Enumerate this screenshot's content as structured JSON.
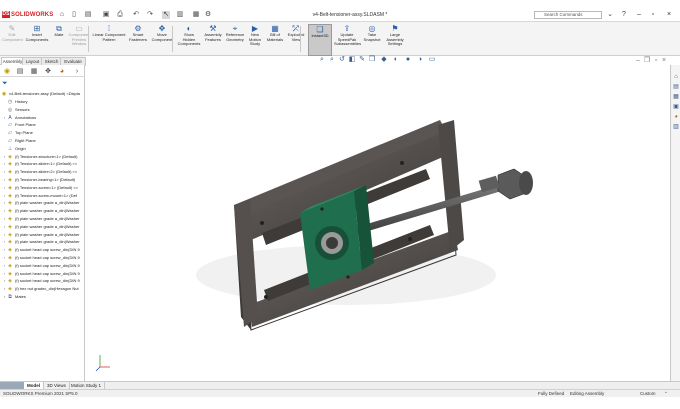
{
  "app": {
    "brand": "SOLIDWORKS",
    "document_title": "v4-Belt-tensioner-assy.SLDASM *",
    "search_placeholder": "Search Commands"
  },
  "command_manager": {
    "items": [
      {
        "label": "Edit\nComponent",
        "icon": "edit-component-icon",
        "disabled": true
      },
      {
        "label": "Insert\nComponents",
        "icon": "insert-components-icon",
        "disabled": false
      },
      {
        "label": "Mate",
        "icon": "mate-icon",
        "disabled": false
      },
      {
        "label": "Component\nPreview\nWindow",
        "icon": "preview-window-icon",
        "disabled": true
      },
      {
        "label": "Linear Component\nPattern",
        "icon": "linear-pattern-icon",
        "disabled": false
      },
      {
        "label": "Smart\nFasteners",
        "icon": "smart-fasteners-icon",
        "disabled": false
      },
      {
        "label": "Move\nComponent",
        "icon": "move-component-icon",
        "disabled": false
      },
      {
        "label": "Show\nHidden\nComponents",
        "icon": "show-hidden-icon",
        "disabled": false
      },
      {
        "label": "Assembly\nFeatures",
        "icon": "assembly-features-icon",
        "disabled": false
      },
      {
        "label": "Reference\nGeometry",
        "icon": "reference-geometry-icon",
        "disabled": false
      },
      {
        "label": "New\nMotion\nStudy",
        "icon": "motion-study-icon",
        "disabled": false
      },
      {
        "label": "Bill of\nMaterials",
        "icon": "bill-of-materials-icon",
        "disabled": false
      },
      {
        "label": "Exploded\nView",
        "icon": "exploded-view-icon",
        "disabled": false
      },
      {
        "label": "Instant3D",
        "icon": "instant3d-icon",
        "disabled": false,
        "active": true
      },
      {
        "label": "Update\nSpeedPak\nSubassemblies",
        "icon": "speedpak-icon",
        "disabled": false
      },
      {
        "label": "Take\nSnapshot",
        "icon": "snapshot-icon",
        "disabled": false
      },
      {
        "label": "Large\nAssembly\nSettings",
        "icon": "large-assembly-icon",
        "disabled": false
      }
    ]
  },
  "tabs": [
    "Assembly",
    "Layout",
    "Sketch",
    "Evaluate"
  ],
  "feature_tree": {
    "root": "v4-Belt-tensioner-assy (Default) <Displa",
    "items": [
      {
        "label": "History",
        "icon": "history-icon",
        "expander": ""
      },
      {
        "label": "Sensors",
        "icon": "sensors-icon",
        "expander": ""
      },
      {
        "label": "Annotations",
        "icon": "annotations-icon",
        "expander": "›"
      },
      {
        "label": "Front Plane",
        "icon": "plane-icon",
        "expander": ""
      },
      {
        "label": "Top Plane",
        "icon": "plane-icon",
        "expander": ""
      },
      {
        "label": "Right Plane",
        "icon": "plane-icon",
        "expander": ""
      },
      {
        "label": "Origin",
        "icon": "origin-icon",
        "expander": ""
      },
      {
        "label": "(f) Tensioner-structure<1> (Default)",
        "icon": "part-icon",
        "expander": "›"
      },
      {
        "label": "(f) Tensioner-slider<1> (Default) <<",
        "icon": "part-icon",
        "expander": "›"
      },
      {
        "label": "(f) Tensioner-slider<2> (Default) <<",
        "icon": "part-icon",
        "expander": "›"
      },
      {
        "label": "(f) Tensioner-bearing<1> (Default)",
        "icon": "part-icon",
        "expander": "›"
      },
      {
        "label": "(f) Tensioner-screw<1> (Default) <<",
        "icon": "part-icon",
        "expander": "›"
      },
      {
        "label": "(f) Tensioner-screw-mount<1> (Def",
        "icon": "part-icon",
        "expander": "›"
      },
      {
        "label": "(f) plain washer grade a_din(Washer",
        "icon": "part-icon",
        "expander": "›"
      },
      {
        "label": "(f) plain washer grade a_din(Washer",
        "icon": "part-icon",
        "expander": "›"
      },
      {
        "label": "(f) plain washer grade a_din(Washer",
        "icon": "part-icon",
        "expander": "›"
      },
      {
        "label": "(f) plain washer grade a_din(Washer",
        "icon": "part-icon",
        "expander": "›"
      },
      {
        "label": "(f) plain washer grade a_din(Washer",
        "icon": "part-icon",
        "expander": "›"
      },
      {
        "label": "(f) plain washer grade a_din(Washer",
        "icon": "part-icon",
        "expander": "›"
      },
      {
        "label": "(f) socket head cap screw_din(DIN 9",
        "icon": "part-icon",
        "expander": "›"
      },
      {
        "label": "(f) socket head cap screw_din(DIN 9",
        "icon": "part-icon",
        "expander": "›"
      },
      {
        "label": "(f) socket head cap screw_din(DIN 9",
        "icon": "part-icon",
        "expander": "›"
      },
      {
        "label": "(f) socket head cap screw_din(DIN 9",
        "icon": "part-icon",
        "expander": "›"
      },
      {
        "label": "(f) socket head cap screw_din(DIN 9",
        "icon": "part-icon",
        "expander": "›"
      },
      {
        "label": "(f) hex nut gradec_din(Hexagon Nut",
        "icon": "part-icon",
        "expander": "›"
      },
      {
        "label": "Mates",
        "icon": "mates-icon",
        "expander": "›"
      }
    ]
  },
  "bottom_tabs": [
    "Model",
    "3D Views",
    "Motion Study 1"
  ],
  "status_bar": {
    "product": "SOLIDWORKS Premium 2021 SP5.0",
    "state": "Fully Defined",
    "mode": "Editing Assembly",
    "units": "Custom"
  },
  "colors": {
    "accent": "#2a5fa8",
    "brand_red": "#d2232a",
    "bearing_green": "#1f6e4e",
    "frame_gray": "#4a4644"
  }
}
